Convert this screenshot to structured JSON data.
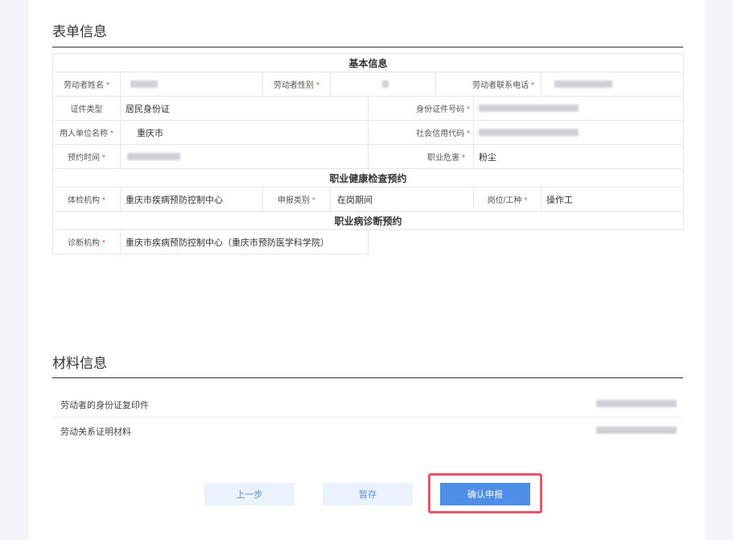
{
  "form_section": {
    "title": "表单信息",
    "basic_header": "基本信息",
    "health_header": "职业健康检查预约",
    "diagnosis_header": "职业病诊断预约",
    "required_mark": "*",
    "fields": {
      "worker_name": {
        "label": "劳动者姓名",
        "value": ""
      },
      "worker_gender": {
        "label": "劳动者性别",
        "value": ""
      },
      "worker_phone": {
        "label": "劳动者联系电话",
        "value": ""
      },
      "id_type": {
        "label": "证件类型",
        "value": "居民身份证"
      },
      "id_number": {
        "label": "身份证件号码",
        "value": ""
      },
      "employer_name": {
        "label": "用人单位名称",
        "value": "重庆市"
      },
      "credit_code": {
        "label": "社会信用代码",
        "value": ""
      },
      "appointment_time": {
        "label": "预约时间",
        "value": ""
      },
      "occupational_hazard": {
        "label": "职业危害",
        "value": "粉尘"
      },
      "exam_org": {
        "label": "体检机构",
        "value": "重庆市疾病预防控制中心"
      },
      "report_type": {
        "label": "申报类别",
        "value": "在岗期间"
      },
      "position": {
        "label": "岗位/工种",
        "value": "操作工"
      },
      "diagnosis_org": {
        "label": "诊断机构",
        "value": "重庆市疾病预防控制中心（重庆市预防医学科学院）"
      }
    }
  },
  "materials_section": {
    "title": "材料信息",
    "items": [
      {
        "name": "劳动者的身份证复印件"
      },
      {
        "name": "劳动关系证明材料"
      }
    ]
  },
  "actions": {
    "prev": "上一步",
    "save": "暂存",
    "confirm": "确认申报"
  },
  "colors": {
    "primary": "#4e8ee8",
    "light_button": "#eaf2fd",
    "highlight": "#e4566b",
    "required": "#e04b4b"
  }
}
